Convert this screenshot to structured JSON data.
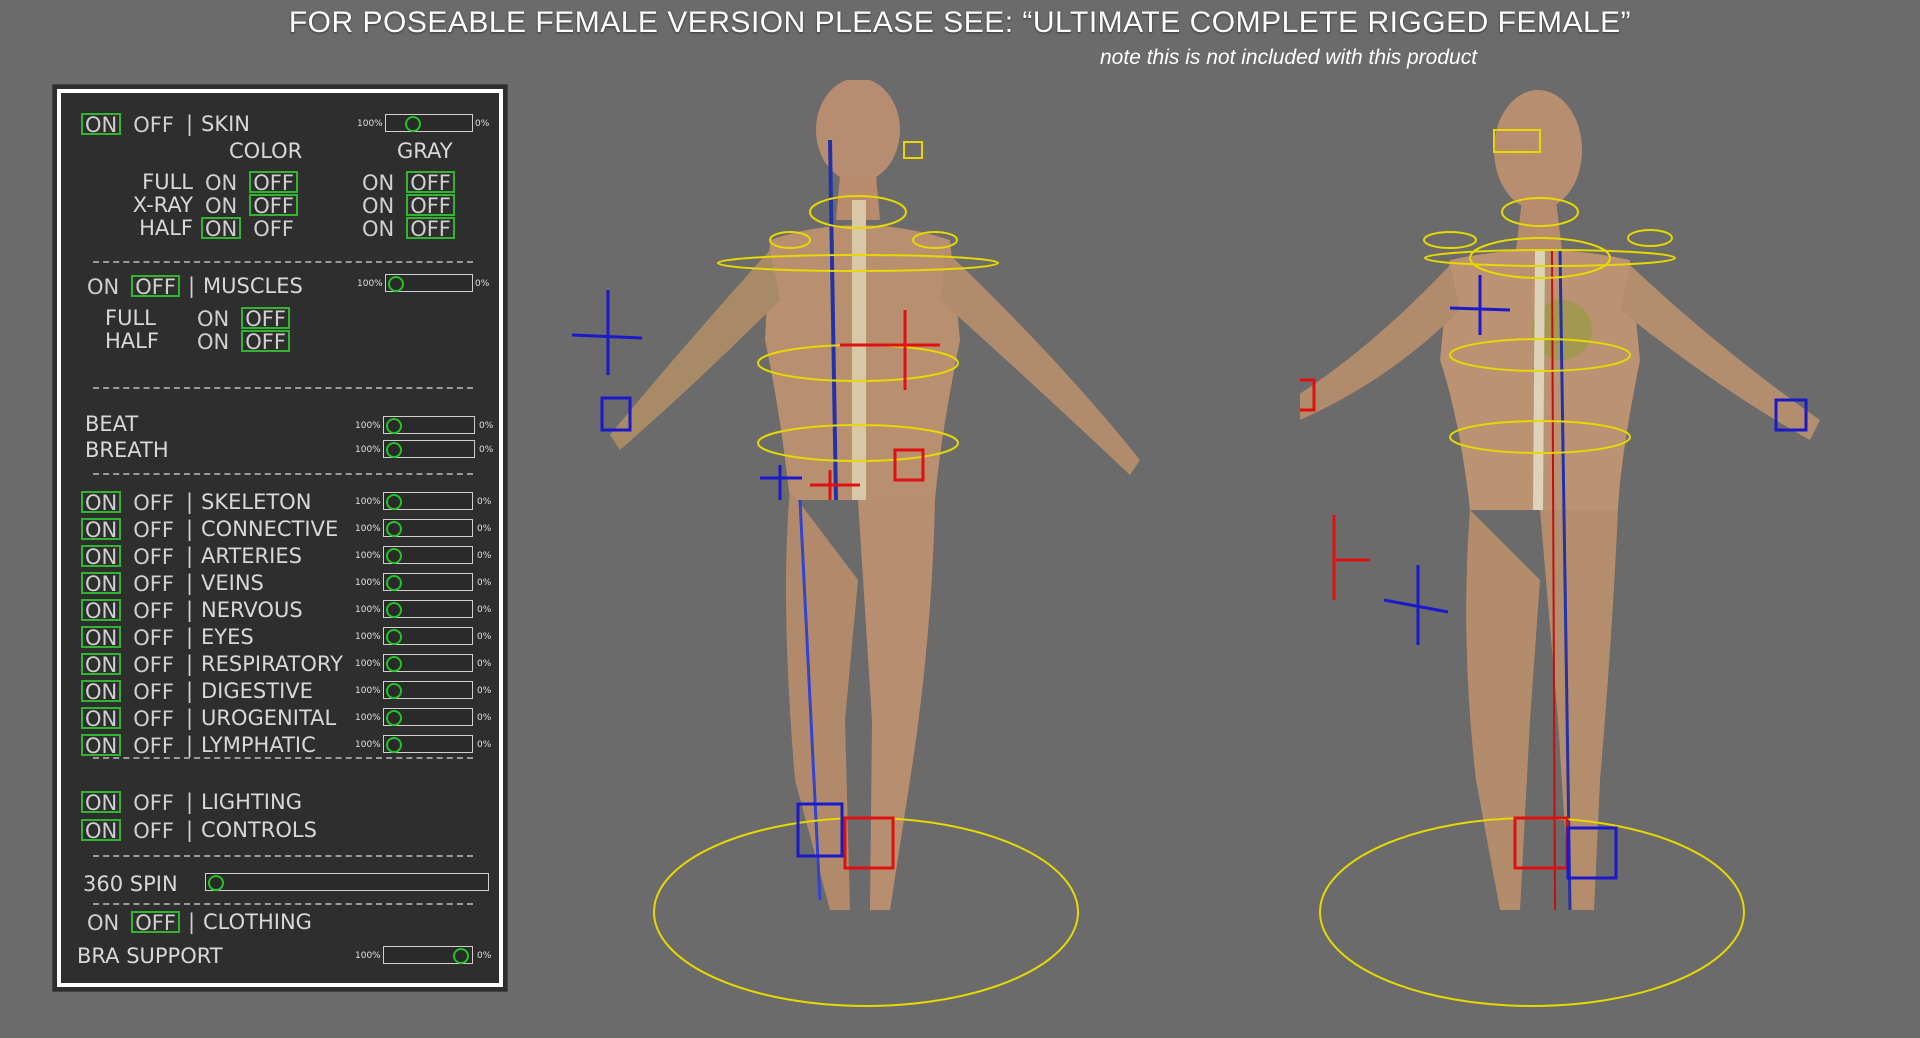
{
  "banner": {
    "title": "FOR POSEABLE FEMALE VERSION PLEASE SEE:   “ULTIMATE COMPLETE RIGGED FEMALE”",
    "note": "note this is not included with this product"
  },
  "labels": {
    "on": "ON",
    "off": "OFF",
    "bar": "|"
  },
  "slider_pct": {
    "left": "100%",
    "right": "0%"
  },
  "skin": {
    "label": "SKIN",
    "color": "COLOR",
    "gray": "GRAY",
    "slider": 0.25,
    "rows": [
      {
        "label": "FULL",
        "color": "off",
        "gray": "off"
      },
      {
        "label": "X-RAY",
        "color": "off",
        "gray": "off"
      },
      {
        "label": "HALF",
        "color": "on",
        "gray": "off"
      }
    ]
  },
  "muscles": {
    "label": "MUSCLES",
    "state": "off",
    "slider": 0.0,
    "rows": [
      {
        "label": "FULL",
        "state": "off"
      },
      {
        "label": "HALF",
        "state": "off"
      }
    ]
  },
  "beat": {
    "label": "BEAT",
    "slider": 0.0
  },
  "breath": {
    "label": "BREATH",
    "slider": 0.0
  },
  "systems": [
    {
      "label": "SKELETON",
      "slider": 0.0
    },
    {
      "label": "CONNECTIVE",
      "slider": 0.0
    },
    {
      "label": "ARTERIES",
      "slider": 0.0
    },
    {
      "label": "VEINS",
      "slider": 0.0
    },
    {
      "label": "NERVOUS",
      "slider": 0.0
    },
    {
      "label": "EYES",
      "slider": 0.0
    },
    {
      "label": "RESPIRATORY",
      "slider": 0.0
    },
    {
      "label": "DIGESTIVE",
      "slider": 0.0
    },
    {
      "label": "UROGENITAL",
      "slider": 0.0
    },
    {
      "label": "LYMPHATIC",
      "slider": 0.0
    }
  ],
  "lighting": {
    "label": "LIGHTING"
  },
  "controls": {
    "label": "CONTROLS"
  },
  "spin": {
    "label": "360 SPIN",
    "slider": 0.0
  },
  "clothing": {
    "label": "CLOTHING",
    "state": "off"
  },
  "bra": {
    "label": "BRA  SUPPORT",
    "slider": 0.95
  },
  "colors": {
    "toggle_active": "#2fb52f",
    "rig_yellow": "#e6d800",
    "rig_red": "#e01010",
    "rig_blue": "#1a1acc"
  }
}
